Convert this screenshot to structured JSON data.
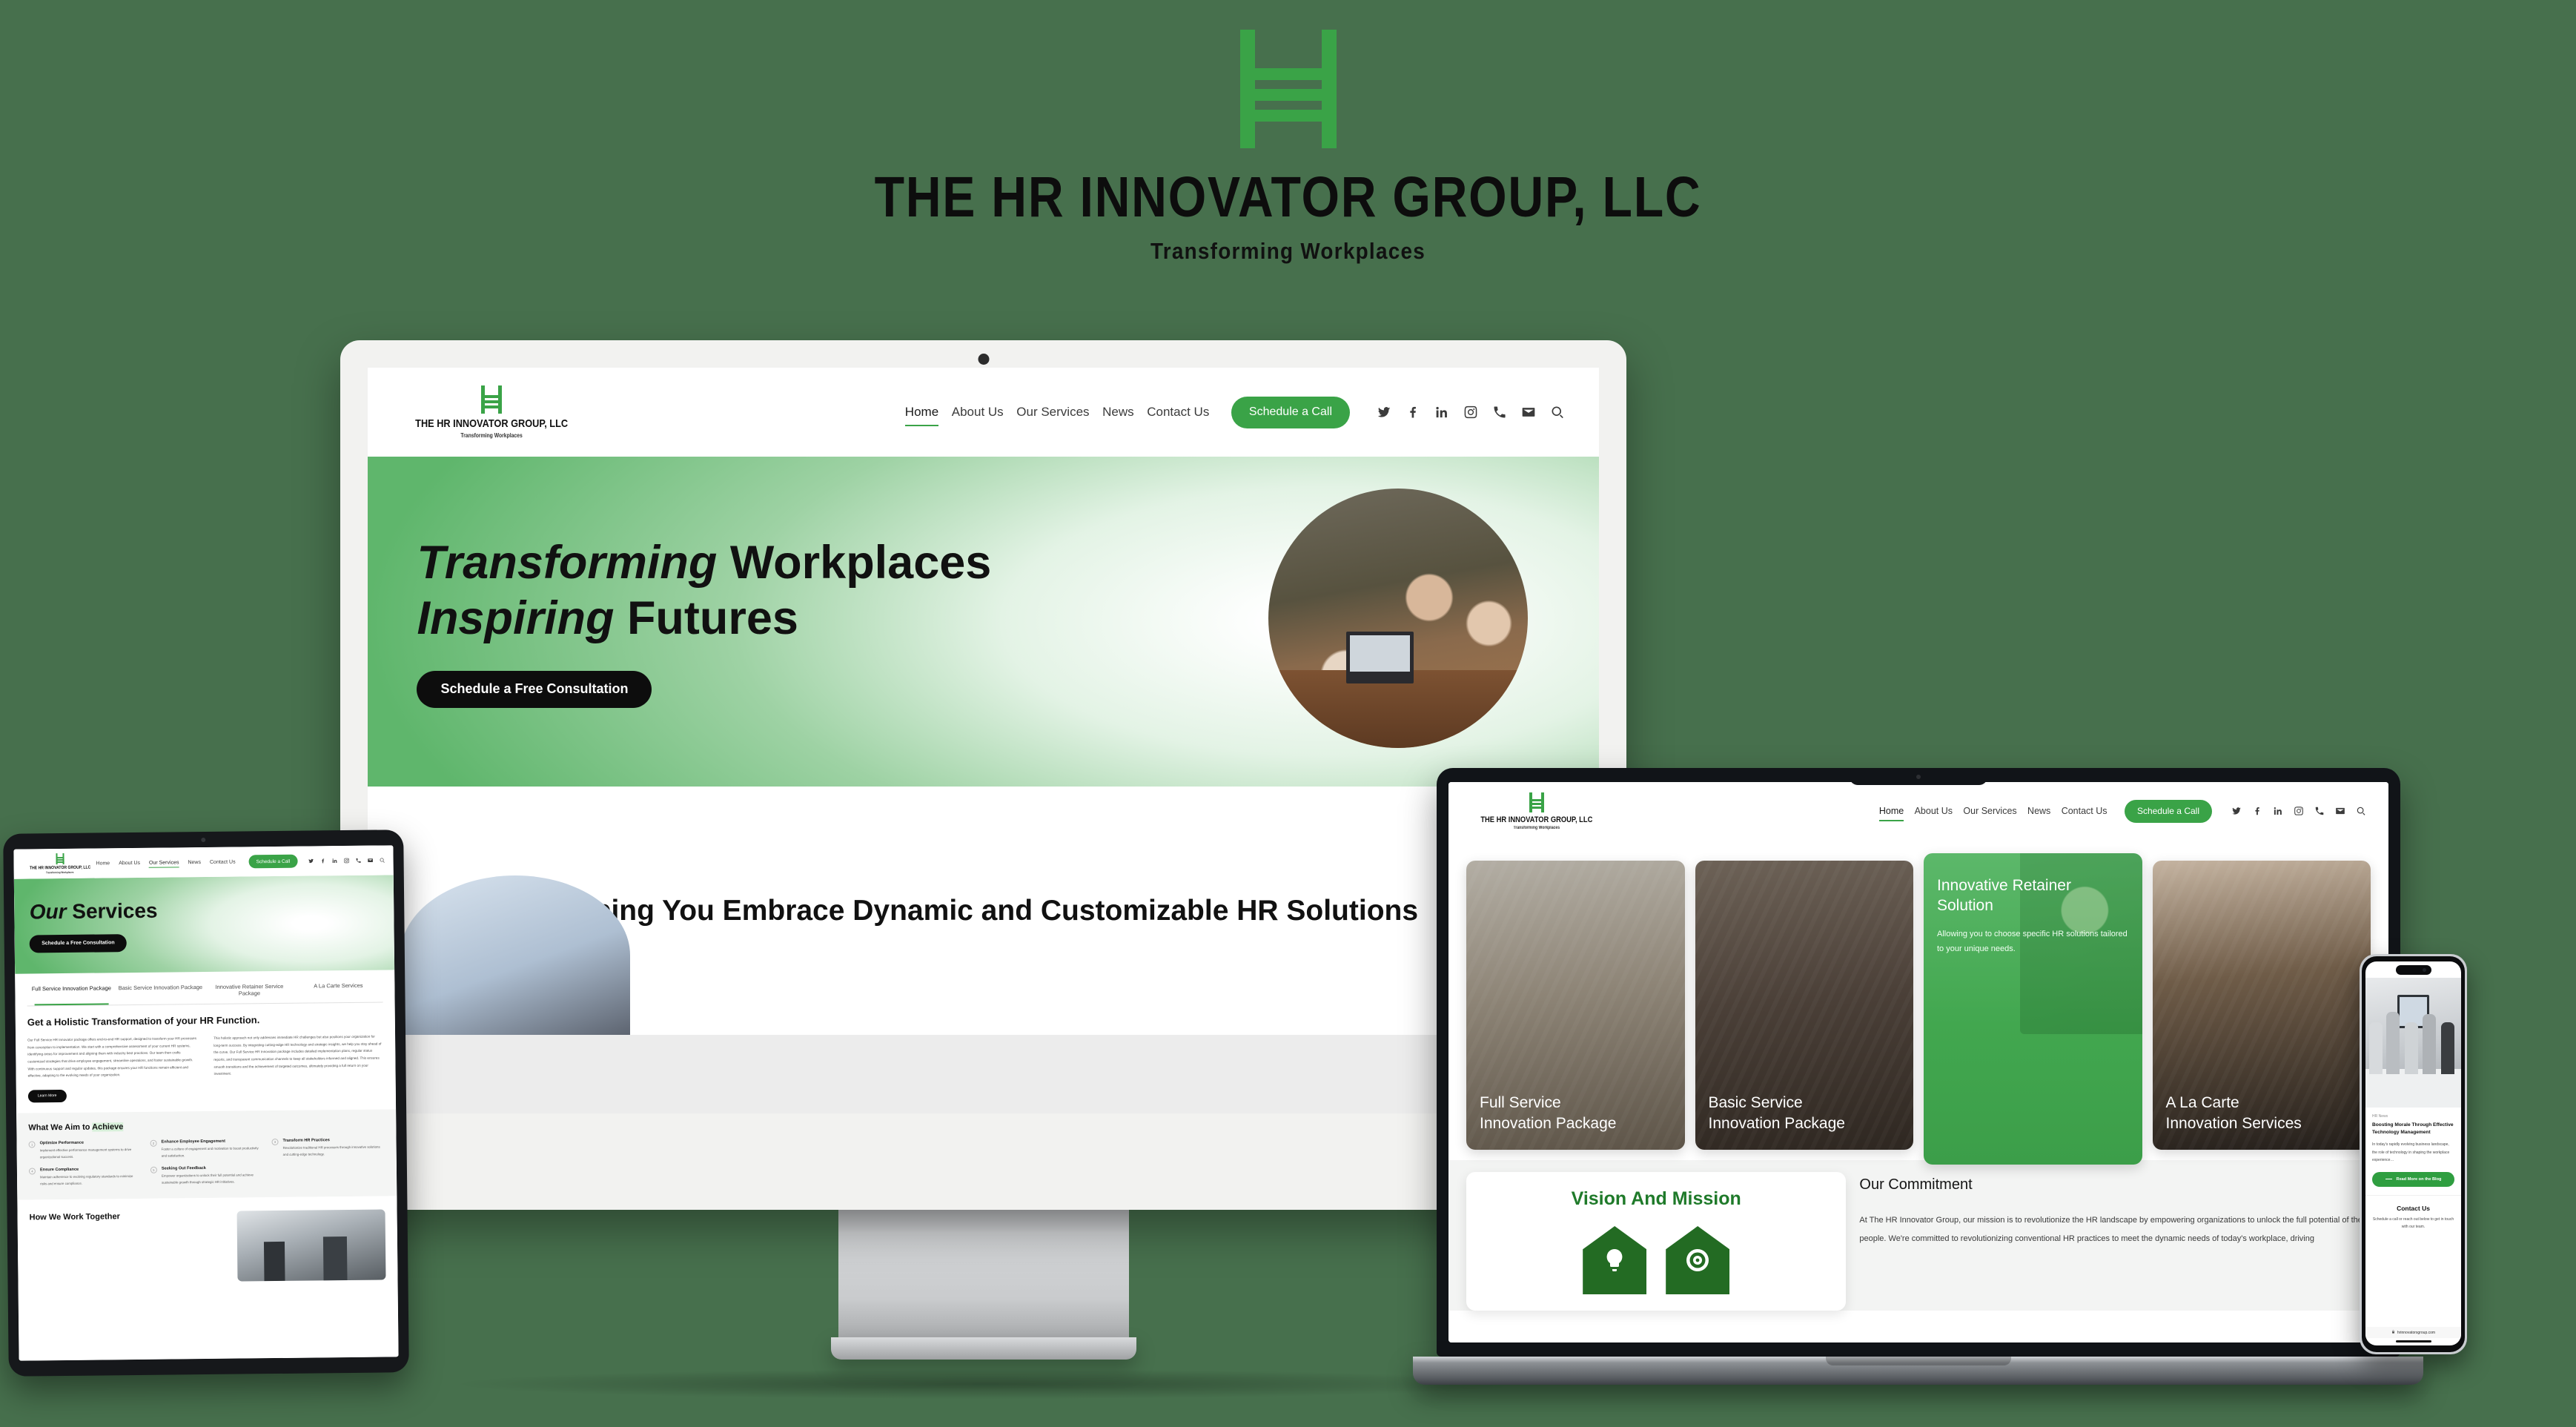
{
  "brand": {
    "title": "THE HR INNOVATOR GROUP, LLC",
    "tagline": "Transforming  Workplaces",
    "logo_icon": "ladder-h-logo-icon",
    "accent_green": "#3aa347",
    "background_green": "#47704d"
  },
  "nav": {
    "logo_name": "THE HR INNOVATOR GROUP, LLC",
    "logo_tagline": "Transforming Workplaces",
    "links": [
      {
        "label": "Home",
        "active": true
      },
      {
        "label": "About Us",
        "active": false
      },
      {
        "label": "Our Services",
        "active": false
      },
      {
        "label": "News",
        "active": false
      },
      {
        "label": "Contact Us",
        "active": false
      }
    ],
    "cta_label": "Schedule a Call",
    "social": [
      "twitter-icon",
      "facebook-icon",
      "linkedin-icon",
      "instagram-icon",
      "phone-icon",
      "email-icon",
      "search-icon"
    ]
  },
  "desktop": {
    "hero": {
      "line1_italic": "Transforming",
      "line1_rest": " Workplaces",
      "line2_italic": "Inspiring",
      "line2_rest": " Futures",
      "button_label": "Schedule a Free Consultation",
      "photo_alt": "three-women-meeting-photo"
    },
    "band": {
      "headline": "Helping You Embrace Dynamic and Customizable HR Solutions",
      "photo_alt": "whiteboard-session-photo"
    }
  },
  "laptop": {
    "services": [
      {
        "title_line1": "Full Service",
        "title_line2": "Innovation Package",
        "highlighted": false,
        "description": ""
      },
      {
        "title_line1": "Basic Service",
        "title_line2": "Innovation Package",
        "highlighted": false,
        "description": ""
      },
      {
        "title_line1": "Innovative Retainer",
        "title_line2": "Solution",
        "highlighted": true,
        "description": "Allowing you to choose specific HR solutions tailored to your unique needs."
      },
      {
        "title_line1": "A La Carte",
        "title_line2": "Innovation Services",
        "highlighted": false,
        "description": ""
      }
    ],
    "vision": {
      "title": "Vision And Mission",
      "icons": [
        "lightbulb-icon",
        "target-icon"
      ]
    },
    "commitment": {
      "heading": "Our Commitment",
      "body": "At The HR Innovator Group, our mission is to revolutionize the HR landscape by empowering organizations to unlock the full potential of their people. We're committed to revolutionizing conventional HR practices to meet the dynamic needs of today's workplace, driving"
    }
  },
  "tablet": {
    "hero": {
      "title_italic": "Our",
      "title_rest": " Services",
      "button_label": "Schedule a Free Consultation"
    },
    "tabs": [
      {
        "label": "Full Service Innovation Package",
        "active": true
      },
      {
        "label": "Basic Service Innovation Package",
        "active": false
      },
      {
        "label": "Innovative Retainer Service Package",
        "active": false
      },
      {
        "label": "A La Carte Services",
        "active": false
      }
    ],
    "section": {
      "heading": "Get a Holistic Transformation of your HR Function.",
      "column_left": "Our Full Service HR Innovator package offers end-to-end HR support, designed to transform your HR processes from conception to implementation. We start with a comprehensive assessment of your current HR systems, identifying areas for improvement and aligning them with industry best practices. Our team then crafts customized strategies that drive employee engagement, streamline operations, and foster sustainable growth. With continuous support and regular updates, this package ensures your HR functions remain efficient and effective, adapting to the evolving needs of your organization.",
      "column_right": "This holistic approach not only addresses immediate HR challenges but also positions your organization for long-term success. By integrating cutting-edge HR technology and strategic insights, we help you stay ahead of the curve. Our Full Service HR Innovation package includes detailed implementation plans, regular status reports, and transparent communication channels to keep all stakeholders informed and aligned. This ensures smooth transitions and the achievement of targeted outcomes, ultimately providing a full return on your investment.",
      "learn_more_label": "Learn More"
    },
    "aim": {
      "heading_plain": "What We Aim to ",
      "heading_highlight": "Achieve",
      "items": [
        {
          "num": "1",
          "title": "Optimize Performance",
          "desc": "Implement effective performance management systems to drive organizational success."
        },
        {
          "num": "2",
          "title": "Enhance Employee Engagement",
          "desc": "Foster a culture of engagement and motivation to boost productivity and satisfaction."
        },
        {
          "num": "3",
          "title": "Transform HR Practices",
          "desc": "Revolutionize traditional HR processes through innovative solutions and cutting-edge technology."
        },
        {
          "num": "4",
          "title": "Ensure Compliance",
          "desc": "Maintain adherence to evolving regulatory standards to minimize risks and ensure compliance."
        },
        {
          "num": "5",
          "title": "Seeking Out Feedback",
          "desc": "Empower organizations to unlock their full potential and achieve sustainable growth through strategic HR initiatives."
        }
      ]
    },
    "work": {
      "heading": "How We Work Together",
      "photo_alt": "team-collaboration-photo"
    }
  },
  "phone": {
    "news": {
      "kicker": "HR News",
      "headline": "Boosting Morale Through Effective Technology Management",
      "excerpt": "In today's rapidly evolving business landscape, the role of technology in shaping the workplace experience…",
      "photo_alt": "team-high-five-photo",
      "button_label": "Read More on the Blog"
    },
    "contact": {
      "heading": "Contact Us",
      "body": "Schedule a call or reach out below to get in touch with our team."
    },
    "url": "hrinnovatorsgroup.com",
    "url_icon": "lock-icon"
  }
}
